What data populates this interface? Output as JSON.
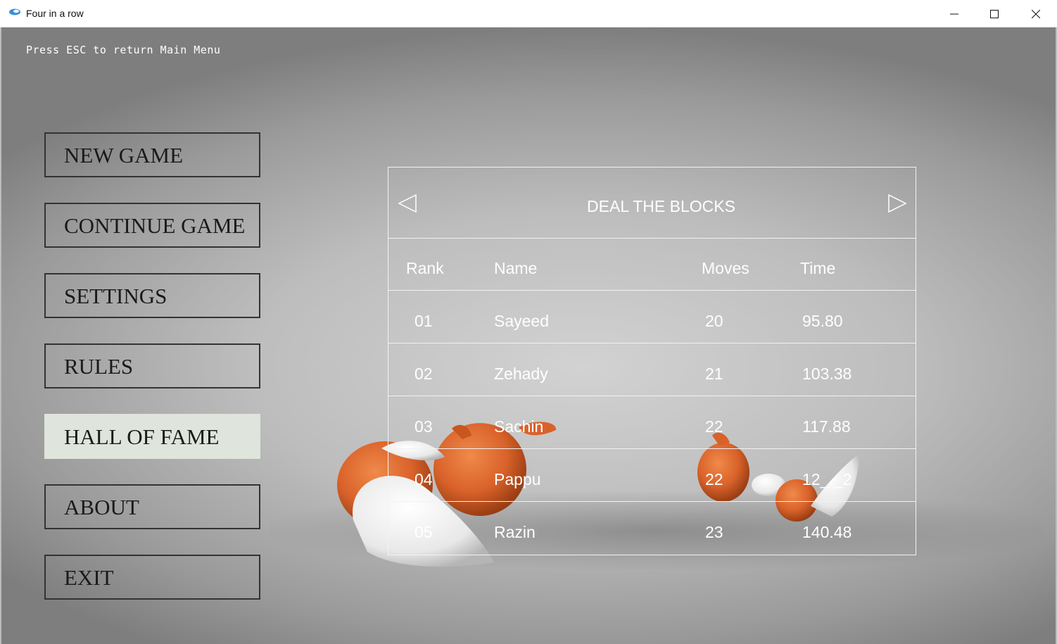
{
  "window": {
    "title": "Four in a row",
    "controls": [
      "minimize-icon",
      "maximize-icon",
      "close-icon"
    ]
  },
  "hint": "Press ESC to return Main Menu",
  "menu": {
    "items": [
      {
        "label": "NEW GAME",
        "active": false
      },
      {
        "label": "CONTINUE GAME",
        "active": false
      },
      {
        "label": "SETTINGS",
        "active": false
      },
      {
        "label": "RULES",
        "active": false
      },
      {
        "label": "HALL OF FAME",
        "active": true
      },
      {
        "label": "ABOUT",
        "active": false
      },
      {
        "label": "EXIT",
        "active": false
      }
    ]
  },
  "hall_of_fame": {
    "title": "DEAL THE BLOCKS",
    "prev_icon": "triangle-left-icon",
    "next_icon": "triangle-right-icon",
    "columns": [
      "Rank",
      "Name",
      "Moves",
      "Time"
    ],
    "rows": [
      {
        "rank": "01",
        "name": "Sayeed",
        "moves": "20",
        "time": "95.80"
      },
      {
        "rank": "02",
        "name": "Zehady",
        "moves": "21",
        "time": "103.38"
      },
      {
        "rank": "03",
        "name": "Sachin",
        "moves": "22",
        "time": "117.88"
      },
      {
        "rank": "04",
        "name": "Pappu",
        "moves": "22",
        "time": "12_._2"
      },
      {
        "rank": "05",
        "name": "Razin",
        "moves": "23",
        "time": "140.48"
      }
    ]
  },
  "colors": {
    "active_menu": "#dfe4dc",
    "accent_orange": "#d9622a",
    "text_light": "#ffffff"
  }
}
